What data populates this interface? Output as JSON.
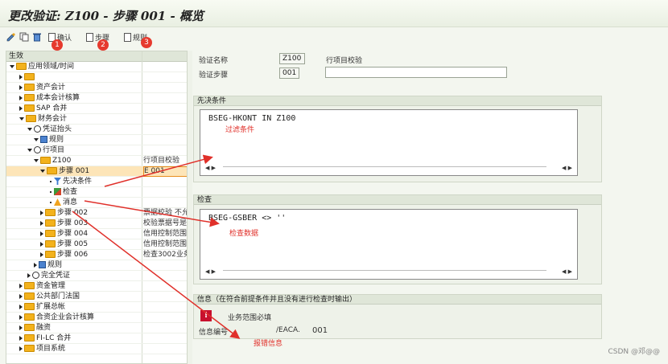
{
  "window": {
    "title": "更改验证: Z100 - 步骤 001 - 概览"
  },
  "toolbar": {
    "btn_confirm": "确认",
    "btn_steps": "步骤",
    "btn_rules": "规则",
    "badges": [
      "1",
      "2",
      "3"
    ]
  },
  "tree": {
    "header": "生效",
    "rows": [
      {
        "label": "应用领域/时间",
        "col2": ""
      },
      {
        "label": "",
        "col2": ""
      },
      {
        "label": "资产会计",
        "col2": ""
      },
      {
        "label": "成本会计核算",
        "col2": ""
      },
      {
        "label": "SAP 合并",
        "col2": ""
      },
      {
        "label": "财务会计",
        "col2": ""
      },
      {
        "label": "凭证抬头",
        "col2": ""
      },
      {
        "label": "规则",
        "col2": ""
      },
      {
        "label": "行项目",
        "col2": ""
      },
      {
        "label": "Z100",
        "col2": "行项目校验"
      },
      {
        "label": "步骤 001",
        "col2": "E 001"
      },
      {
        "label": "先决条件",
        "col2": ""
      },
      {
        "label": "检查",
        "col2": ""
      },
      {
        "label": "消息",
        "col2": ""
      },
      {
        "label": "步骤 002",
        "col2": "票据校验 不允"
      },
      {
        "label": "步骤 003",
        "col2": "校验票据号是"
      },
      {
        "label": "步骤 004",
        "col2": "信用控制范围"
      },
      {
        "label": "步骤 005",
        "col2": "信用控制范围"
      },
      {
        "label": "步骤 006",
        "col2": "检查3002业务"
      },
      {
        "label": "规则",
        "col2": ""
      },
      {
        "label": "完全凭证",
        "col2": ""
      },
      {
        "label": "资金管理",
        "col2": ""
      },
      {
        "label": "公共部门法国",
        "col2": ""
      },
      {
        "label": "扩展总帐",
        "col2": ""
      },
      {
        "label": "合资企业会计核算",
        "col2": ""
      },
      {
        "label": "融资",
        "col2": ""
      },
      {
        "label": "FI-LC 合并",
        "col2": ""
      },
      {
        "label": "项目系统",
        "col2": ""
      }
    ]
  },
  "form": {
    "val_name_label": "验证名称",
    "val_name_value": "Z100",
    "val_name_desc": "行项目校验",
    "step_label": "验证步骤",
    "step_value": "001",
    "step_desc": ""
  },
  "prereq": {
    "title": "先决条件",
    "code": "BSEG-HKONT IN Z100",
    "note": "过滤条件"
  },
  "check": {
    "title": "检查",
    "code": "BSEG-GSBER <> ''",
    "note": "检查数据"
  },
  "message": {
    "title": "信息（在符合前提条件并且没有进行检查时输出）",
    "text": "业务范围必填",
    "id_label": "信息编号",
    "id_class": "/EACA.",
    "id_num": "001",
    "note": "报错信息"
  },
  "watermark": "CSDN @邓@@",
  "colors": {
    "annotation": "#e0302a",
    "selection": "#fde5b8",
    "folder": "#f3b21c"
  }
}
